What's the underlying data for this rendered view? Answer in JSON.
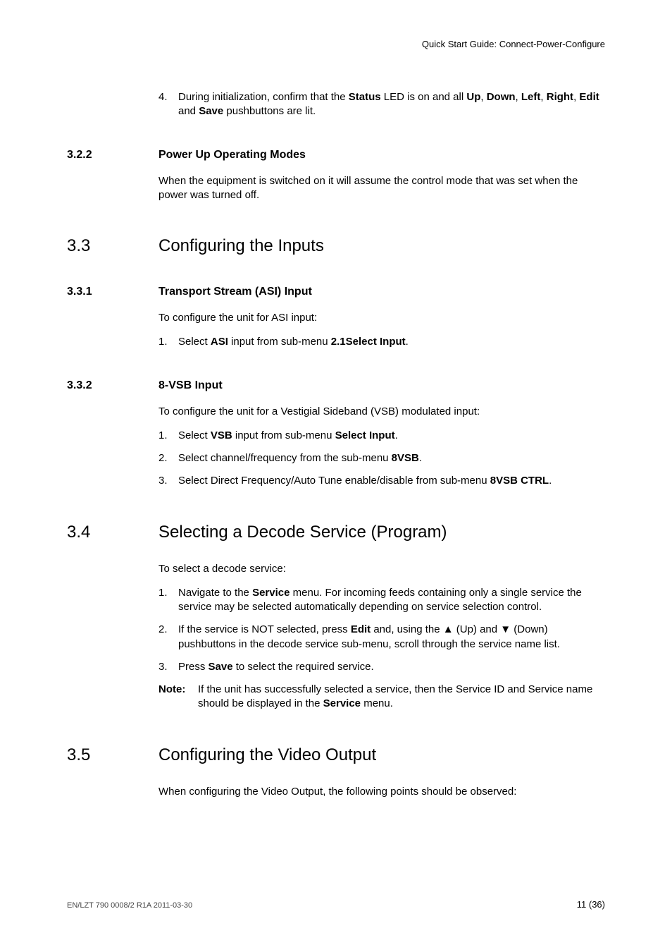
{
  "header": {
    "running": "Quick Start Guide: Connect-Power-Configure"
  },
  "intro_item": {
    "marker": "4.",
    "body_prefix": "During initialization, confirm that the ",
    "status": "Status",
    "mid1": " LED is on and all ",
    "up": "Up",
    "comma1": ", ",
    "down": "Down",
    "comma2": ", ",
    "left": "Left",
    "comma3": ", ",
    "right": "Right",
    "comma4": ", ",
    "edit": "Edit",
    "and": " and ",
    "save": "Save",
    "tail": " pushbuttons are lit."
  },
  "s322": {
    "num": "3.2.2",
    "title": "Power Up Operating Modes",
    "p1": "When the equipment is switched on it will assume the control mode that was set when the power was turned off."
  },
  "s33": {
    "num": "3.3",
    "title": "Configuring the Inputs"
  },
  "s331": {
    "num": "3.3.1",
    "title": "Transport Stream (ASI) Input",
    "p1": "To configure the unit for ASI input:",
    "i1": {
      "marker": "1.",
      "pre": "Select ",
      "asi": "ASI",
      "mid": " input from sub-menu ",
      "menu": "2.1Select Input",
      "post": "."
    }
  },
  "s332": {
    "num": "3.3.2",
    "title": "8-VSB Input",
    "p1": "To configure the unit for a Vestigial Sideband (VSB) modulated input:",
    "i1": {
      "marker": "1.",
      "pre": "Select ",
      "vsb": "VSB",
      "mid": " input from sub-menu ",
      "menu": "Select Input",
      "post": "."
    },
    "i2": {
      "marker": "2.",
      "pre": "Select channel/frequency from the sub-menu ",
      "menu": "8VSB",
      "post": "."
    },
    "i3": {
      "marker": "3.",
      "pre": "Select Direct Frequency/Auto Tune enable/disable from sub-menu ",
      "menu": "8VSB CTRL",
      "post": "."
    }
  },
  "s34": {
    "num": "3.4",
    "title": "Selecting a Decode Service (Program)",
    "p1": "To select a decode service:",
    "i1": {
      "marker": "1.",
      "pre": "Navigate to the ",
      "svc": "Service",
      "post": " menu. For incoming feeds containing only a single service the service may be selected automatically depending on service selection control."
    },
    "i2": {
      "marker": "2.",
      "pre": "If the service is NOT selected, press ",
      "edit": "Edit",
      "mid1": " and, using the ▲ (Up) and ▼ (Down) pushbuttons in the decode service sub-menu, scroll through the service name list."
    },
    "i3": {
      "marker": "3.",
      "pre": "Press ",
      "save": "Save",
      "post": " to select the required service."
    },
    "note": {
      "label": "Note:",
      "pre": "If the unit has successfully selected a service, then the Service ID and Service name should be displayed in the ",
      "svc": "Service",
      "post": " menu."
    }
  },
  "s35": {
    "num": "3.5",
    "title": "Configuring the Video Output",
    "p1": "When configuring the Video Output, the following points should be observed:"
  },
  "footer": {
    "left": "EN/LZT 790 0008/2 R1A 2011-03-30",
    "right": "11 (36)"
  }
}
